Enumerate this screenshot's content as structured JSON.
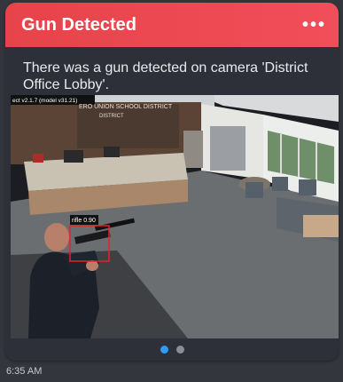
{
  "notification": {
    "title": "Gun Detected",
    "more_label": "•••",
    "message": "There was a gun detected on camera 'District Office Lobby'.",
    "timestamp": "6:35 AM"
  },
  "camera_frame": {
    "model_overlay": "ect v2.1.7 (model v31.21)",
    "wall_sign_line1": "ERO UNION SCHOOL DISTRICT",
    "wall_sign_line2": "DISTRICT",
    "detection_label": "rifle 0.90"
  },
  "pager": {
    "page_count": 2,
    "active_index": 0
  },
  "colors": {
    "header": "#ea4650",
    "active_dot": "#2f9bf5",
    "detection_box": "#e0232b"
  }
}
